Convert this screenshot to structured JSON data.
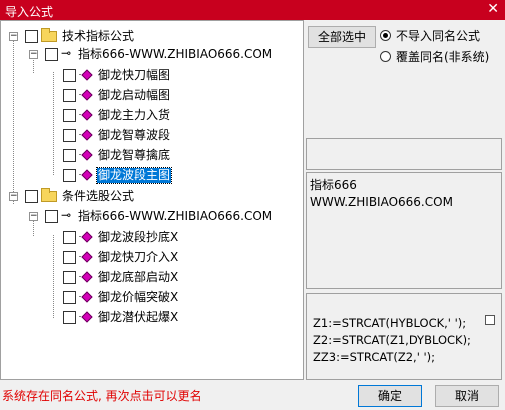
{
  "window": {
    "title": "导入公式",
    "close_label": "✕"
  },
  "tree": {
    "groups": [
      {
        "label": "技术指标公式",
        "expanded": true,
        "child": {
          "label": "指标666-WWW.ZHIBIAO666.COM",
          "items": [
            "御龙快刀幅图",
            "御龙启动幅图",
            "御龙主力入货",
            "御龙智尊波段",
            "御龙智尊擒底",
            "御龙波段主图"
          ],
          "selected_index": 5
        }
      },
      {
        "label": "条件选股公式",
        "expanded": true,
        "child": {
          "label": "指标666-WWW.ZHIBIAO666.COM",
          "items": [
            "御龙波段抄底X",
            "御龙快刀介入X",
            "御龙底部启动X",
            "御龙价幅突破X",
            "御龙潜伏起爆X"
          ]
        }
      }
    ],
    "expand_symbol": "−"
  },
  "options": {
    "select_all_label": "全部选中",
    "radio_no_import_label": "不导入同名公式",
    "radio_overwrite_label": "覆盖同名(非系统)",
    "selected": "no_import"
  },
  "description": {
    "line1": "指标666",
    "line2": "WWW.ZHIBIAO666.COM"
  },
  "code": {
    "lines": [
      "Z1:=STRCAT(HYBLOCK,' ');",
      "Z2:=STRCAT(Z1,DYBLOCK);",
      "ZZ3:=STRCAT(Z2,' ');"
    ]
  },
  "footer": {
    "status": "系统存在同名公式, 再次点击可以更名",
    "ok_label": "确定",
    "cancel_label": "取消"
  },
  "colors": {
    "titlebar": "#c8001e",
    "selection": "#0078d7",
    "status_text": "#e00000",
    "leaf_icon": "#d400b8"
  }
}
